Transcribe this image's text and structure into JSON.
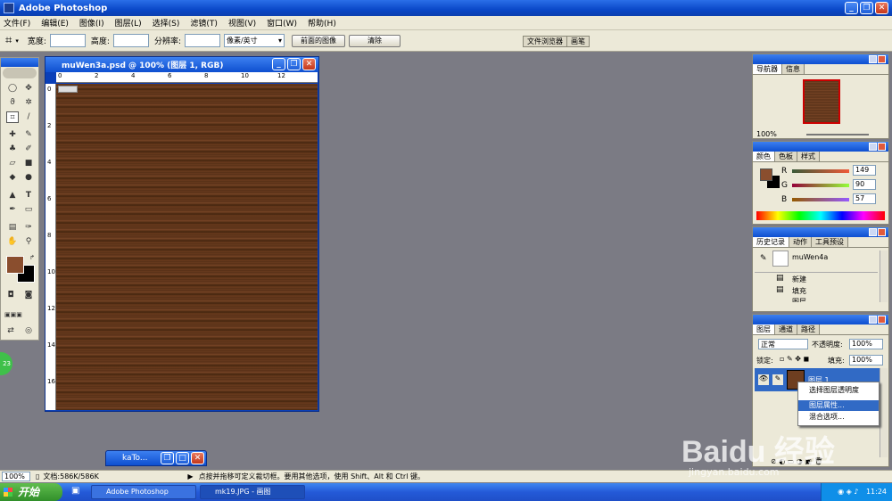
{
  "app": {
    "title": "Adobe Photoshop"
  },
  "menu": [
    "文件(F)",
    "编辑(E)",
    "图像(I)",
    "图层(L)",
    "选择(S)",
    "滤镜(T)",
    "视图(V)",
    "窗口(W)",
    "帮助(H)"
  ],
  "options": {
    "width_label": "宽度:",
    "height_label": "高度:",
    "resolution_label": "分辨率:",
    "unit": "像素/英寸",
    "front_image": "前面的图像",
    "clear": "清除",
    "tabs": [
      "文件浏览器",
      "画笔"
    ]
  },
  "document": {
    "title": "muWen3a.psd @ 100% (图层 1, RGB)",
    "ruler_top": [
      "0",
      "2",
      "4",
      "6",
      "8",
      "10",
      "12"
    ],
    "ruler_left": [
      "0",
      "2",
      "4",
      "6",
      "8",
      "10",
      "12",
      "14",
      "16"
    ]
  },
  "colors": {
    "foreground": "#8a4e2e",
    "background": "#000000",
    "wood": "#5a3219"
  },
  "navigator": {
    "tabs": [
      "导航器",
      "信息"
    ],
    "zoom": "100%"
  },
  "color_panel": {
    "tabs": [
      "颜色",
      "色板",
      "样式"
    ],
    "r_label": "R",
    "g_label": "G",
    "b_label": "B",
    "r": "149",
    "g": "90",
    "b": "57"
  },
  "history": {
    "tabs": [
      "历史记录",
      "动作",
      "工具预设"
    ],
    "snapshot": "muWen4a",
    "items": [
      "新建",
      "填充",
      "图层"
    ]
  },
  "layers": {
    "tabs": [
      "图层",
      "通道",
      "路径"
    ],
    "blend": "正常",
    "opacity_label": "不透明度:",
    "opacity": "100%",
    "lock_label": "锁定:",
    "fill_label": "填充:",
    "fill": "100%",
    "layer_name": "图层 1"
  },
  "context_menu": [
    "选择图层透明度",
    "图层属性...",
    "混合选项..."
  ],
  "minimized": {
    "label": "kaTo..."
  },
  "status": {
    "zoom": "100%",
    "doc": "文档:586K/586K",
    "hint": "点按并拖移可定义裁切框。要用其他选项，使用 Shift、Alt 和 Ctrl 键。"
  },
  "taskbar": {
    "start": "开始",
    "items": [
      "Adobe Photoshop",
      "mk19.JPG - 画图"
    ],
    "time": "11:24"
  },
  "watermark": {
    "brand": "Baidu 经验",
    "url": "jingyan.baidu.com"
  }
}
